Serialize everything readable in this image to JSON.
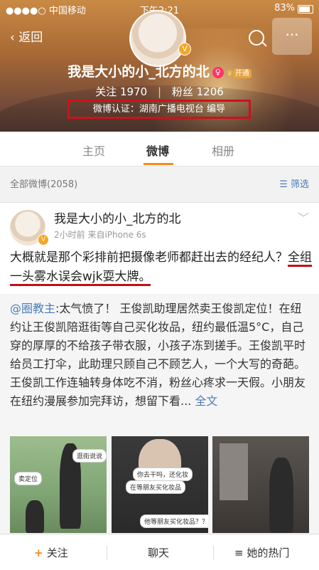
{
  "statusbar": {
    "carrier": "●●●●○ 中国移动",
    "time": "下午2:21",
    "battery": "83%"
  },
  "nav": {
    "back_label": "返回",
    "more_label": "···"
  },
  "profile": {
    "name": "我是大小的小_北方的北",
    "vip_label": "开通",
    "follow_label": "关注",
    "follow_count": "1970",
    "fans_label": "粉丝",
    "fans_count": "1206",
    "cert": "微博认证：湖南广播电视台 编导"
  },
  "tabs": [
    {
      "label": "主页"
    },
    {
      "label": "微博"
    },
    {
      "label": "相册"
    }
  ],
  "filterbar": {
    "count": "全部微博(2058)",
    "filter_label": "筛选"
  },
  "post": {
    "author": "我是大小的小_北方的北",
    "meta": "2小时前  来自iPhone 6s",
    "text_plain": "大概就是那个彩排前把摄像老师都赶出去的经纪人？",
    "text_underlined": "全组一头雾水误会wjk耍大牌。",
    "repost_at": "@圈教主",
    "repost_text": ":太气愤了！ 王俊凯助理居然卖王俊凯定位！在纽约让王俊凯陪逛街等自己买化妆品，纽约最低温5°C，自己穿的厚厚的不给孩子带衣服，小孩子冻到搓手。王俊凯平时给员工打伞，此助理只顾自己不顾艺人，一个大写的奇葩。王俊凯工作连轴转身体吃不消，粉丝心疼求一天假。小朋友在纽约漫展参加完拜访，想留下看...",
    "full_text_label": "全文",
    "images": {
      "img1_bubble_a": "卖定位",
      "img1_bubble_b": "逛街说说",
      "img2_bubble_a": "你去干吗，还化妆",
      "img2_bubble_b": "在等朋友买化妆品",
      "img2_bubble_c": "他等朋友买化妆品？？？"
    }
  },
  "bottombar": {
    "follow": "关注",
    "chat": "聊天",
    "hot": "她的热门"
  },
  "colors": {
    "accent": "#f58b1c",
    "link": "#4a7cb8",
    "highlight_box": "#d0101b"
  }
}
